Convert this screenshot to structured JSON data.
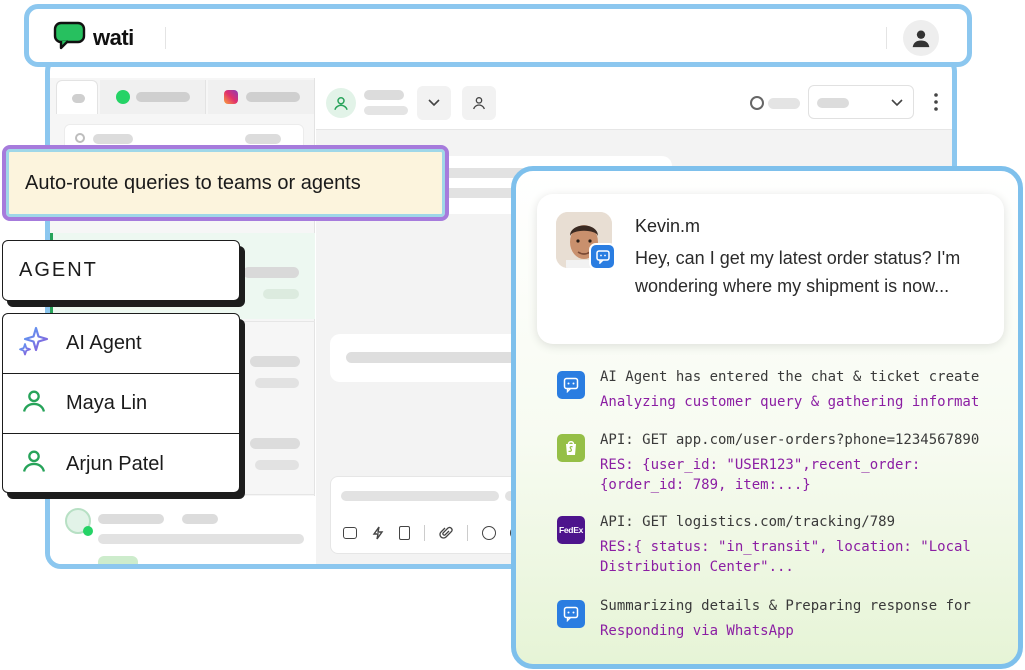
{
  "brand": {
    "name": "wati"
  },
  "colors": {
    "accent_blue": "#8cc7ef",
    "purple_border": "#a67bdc",
    "banner_bg": "#fcf4dd",
    "agent_green": "#27a35a",
    "log_purple": "#8b1ea3",
    "whatsapp_green": "#25d366"
  },
  "banner": {
    "text": "Auto-route queries to teams or agents"
  },
  "assign": {
    "header": "AGENT",
    "options": [
      {
        "label": "AI Agent",
        "icon": "sparkle-icon"
      },
      {
        "label": "Maya Lin",
        "icon": "user-icon"
      },
      {
        "label": "Arjun Patel",
        "icon": "user-icon"
      }
    ]
  },
  "message": {
    "sender": "Kevin.m",
    "text": "Hey, can I get my latest order status? I'm wondering where my shipment is now..."
  },
  "steps": [
    {
      "icon": "chat-icon",
      "line1": "AI Agent has entered the chat & ticket created",
      "line2": "Analyzing customer query & gathering information"
    },
    {
      "icon": "shopify-icon",
      "line1": "API: GET app.com/user-orders?phone=1234567890",
      "line2": "RES: {user_id: \"USER123\",recent_order: {order_id: 789, item:...}"
    },
    {
      "icon": "fedex-icon",
      "line1": "API: GET logistics.com/tracking/789",
      "line2": "RES:{ status: \"in_transit\", location: \"Local Distribution Center\"..."
    },
    {
      "icon": "chat-icon",
      "line1": "Summarizing details & Preparing response for",
      "line2": "Responding via WhatsApp"
    }
  ],
  "fedex_logo": "FedEx"
}
